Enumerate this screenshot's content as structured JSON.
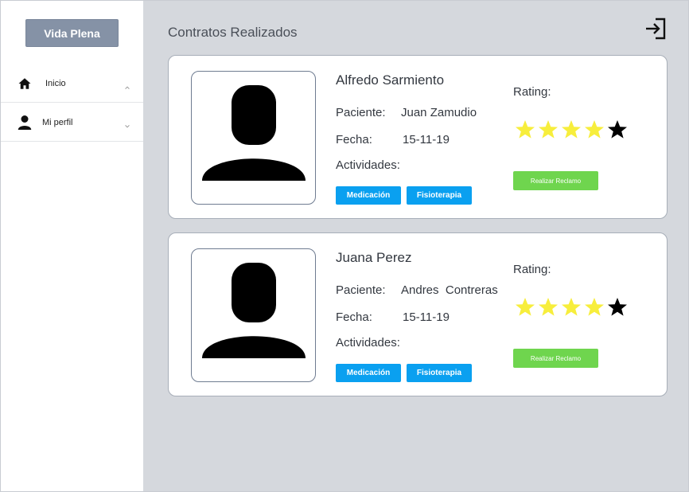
{
  "sidebar": {
    "brand_label": "Vida Plena",
    "items": [
      {
        "label": "Inicio",
        "icon": "home-icon",
        "chevron": "chevron-up-icon"
      },
      {
        "label": "Mi perfil",
        "icon": "user-icon",
        "chevron": "chevron-down-icon"
      }
    ]
  },
  "main": {
    "title": "Contratos Realizados",
    "logout_icon": "logout-icon"
  },
  "labels": {
    "paciente": "Paciente:",
    "fecha": "Fecha:",
    "actividades": "Actividades:",
    "rating": "Rating:",
    "claim_button": "Realizar Reclamo"
  },
  "contracts": [
    {
      "name": "Alfredo Sarmiento",
      "patient": "Juan Zamudio",
      "date": "15-11-19",
      "activities": [
        "Medicación",
        "Fisioterapia"
      ],
      "rating": 4,
      "rating_max": 5
    },
    {
      "name": "Juana Perez",
      "patient": "Andres  Contreras",
      "date": "15-11-19",
      "activities": [
        "Medicación",
        "Fisioterapia"
      ],
      "rating": 4,
      "rating_max": 5
    }
  ],
  "colors": {
    "brand_button": "#8592a6",
    "main_background": "#d5d8dd",
    "tag": "#0aa0f0",
    "claim": "#6fd54e",
    "star_filled": "#f7ee3c",
    "star_empty": "#000000"
  }
}
